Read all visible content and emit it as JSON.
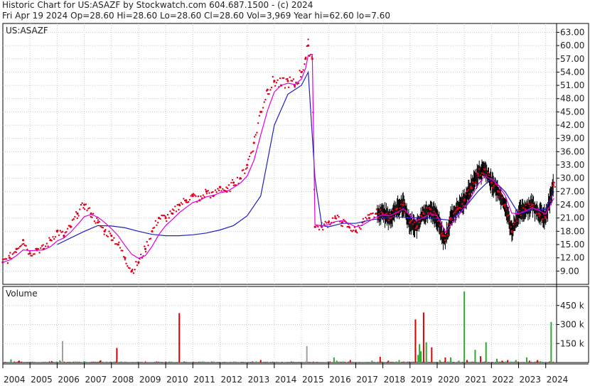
{
  "header": {
    "line1": "Historic Chart for US:ASAZF by Stockwatch.com 604.687.1500 - (c) 2024",
    "line2": "Fri Apr 19 2024   Op=28.60  Hi=28.60  Lo=28.60  Cl=28.60  Vol=3,969   Year hi=62.60   lo=7.60"
  },
  "colors": {
    "price_dot": "#e0001b",
    "ma_short": "#e000e0",
    "ma_long": "#2020c0",
    "grid": "#c8c8c8",
    "vol_up": "#2faa2f",
    "vol_down": "#e00000",
    "vol_flat": "#a0a0a0",
    "candle": "#000000"
  },
  "chart_data": [
    {
      "type": "line",
      "panel": "price",
      "label": "US:ASAZF",
      "y_ticks": [
        9,
        12,
        15,
        18,
        21,
        24,
        27,
        30,
        33,
        36,
        39,
        42,
        45,
        48,
        51,
        54,
        57,
        60,
        63
      ],
      "ylim": [
        6,
        65
      ],
      "xlim": [
        2004.0,
        2024.4
      ],
      "year_labels": [
        "2004",
        "2005",
        "2006",
        "2007",
        "2008",
        "2009",
        "2010",
        "2011",
        "2012",
        "2013",
        "2014",
        "2015",
        "2016",
        "2017",
        "2018",
        "2019",
        "2020",
        "2021",
        "2022",
        "2023",
        "2024"
      ],
      "grid": true,
      "series": [
        {
          "role": "price",
          "x": [
            2004.0,
            2004.25,
            2004.5,
            2004.75,
            2005.0,
            2005.25,
            2005.5,
            2005.75,
            2006.0,
            2006.25,
            2006.5,
            2006.75,
            2007.0,
            2007.25,
            2007.5,
            2007.75,
            2008.0,
            2008.25,
            2008.5,
            2008.75,
            2009.0,
            2009.25,
            2009.5,
            2009.75,
            2010.0,
            2010.25,
            2010.5,
            2010.75,
            2011.0,
            2011.25,
            2011.5,
            2011.75,
            2012.0,
            2012.25,
            2012.5,
            2012.75,
            2013.0,
            2013.25,
            2013.5,
            2013.75,
            2014.0,
            2014.25,
            2014.5,
            2014.75,
            2015.0,
            2015.15,
            2015.25,
            2015.4,
            2015.5,
            2015.75,
            2016.0,
            2016.25,
            2016.5,
            2016.75,
            2017.0,
            2017.25,
            2017.5,
            2017.75,
            2018.0,
            2018.25,
            2018.5,
            2018.75,
            2019.0,
            2019.25,
            2019.5,
            2019.75,
            2020.0,
            2020.2,
            2020.3,
            2020.5,
            2020.75,
            2021.0,
            2021.25,
            2021.5,
            2021.75,
            2022.0,
            2022.25,
            2022.5,
            2022.75,
            2023.0,
            2023.25,
            2023.5,
            2023.75,
            2024.0,
            2024.3
          ],
          "values": [
            11,
            12,
            14,
            16,
            13,
            14,
            14,
            16,
            18,
            17,
            19,
            22,
            24,
            22,
            20,
            18,
            17,
            15,
            12,
            9,
            11,
            14,
            18,
            21,
            21,
            22,
            24,
            25,
            26,
            25,
            27,
            26,
            28,
            27,
            29,
            30,
            33,
            38,
            45,
            50,
            52,
            51,
            52,
            51,
            54,
            57,
            60,
            57,
            19,
            19,
            20,
            21,
            20,
            19,
            18,
            20,
            21,
            22,
            22,
            21,
            23,
            24,
            20,
            19,
            22,
            23,
            21,
            17,
            16,
            21,
            23,
            25,
            28,
            31,
            32,
            29,
            27,
            24,
            18,
            22,
            23,
            24,
            22,
            21,
            29
          ]
        },
        {
          "role": "moving_average_short",
          "x": [
            2004.0,
            2004.25,
            2004.5,
            2004.75,
            2005.0,
            2005.25,
            2005.5,
            2005.75,
            2006.0,
            2006.25,
            2006.5,
            2006.75,
            2007.0,
            2007.25,
            2007.5,
            2007.75,
            2008.0,
            2008.25,
            2008.5,
            2008.75,
            2009.0,
            2009.25,
            2009.5,
            2009.75,
            2010.0,
            2010.25,
            2010.5,
            2010.75,
            2011.0,
            2011.25,
            2011.5,
            2011.75,
            2012.0,
            2012.25,
            2012.5,
            2012.75,
            2013.0,
            2013.25,
            2013.5,
            2013.75,
            2014.0,
            2014.25,
            2014.5,
            2014.75,
            2015.0,
            2015.15,
            2015.25,
            2015.4,
            2015.5,
            2015.75,
            2016.0,
            2016.25,
            2016.5,
            2016.75,
            2017.0,
            2017.25,
            2017.5,
            2017.75,
            2018.0,
            2018.25,
            2018.5,
            2018.75,
            2019.0,
            2019.25,
            2019.5,
            2019.75,
            2020.0,
            2020.2,
            2020.3,
            2020.5,
            2020.75,
            2021.0,
            2021.25,
            2021.5,
            2021.75,
            2022.0,
            2022.25,
            2022.5,
            2022.75,
            2023.0,
            2023.25,
            2023.5,
            2023.75,
            2024.0,
            2024.3
          ],
          "values": [
            11,
            11.5,
            12.5,
            13.8,
            13.6,
            13.7,
            13.8,
            14.5,
            15.8,
            16.5,
            17.8,
            19.5,
            21.3,
            21.8,
            21.2,
            20,
            18.6,
            17,
            14.8,
            12.8,
            11.9,
            12.5,
            14.6,
            17.3,
            19.3,
            20.7,
            22.2,
            23.4,
            24.5,
            25,
            25.8,
            26.1,
            26.7,
            27,
            27.9,
            28.9,
            30.5,
            34,
            39.8,
            45.3,
            49.5,
            51,
            51.5,
            51.2,
            52.4,
            54.8,
            57.8,
            58,
            19.5,
            19.2,
            19.5,
            20.2,
            20.4,
            19.8,
            19,
            19.4,
            20.3,
            21.2,
            21.7,
            21.5,
            22.2,
            23.1,
            21.6,
            20.4,
            21.1,
            22,
            21.5,
            19.2,
            17.8,
            19.4,
            21.3,
            23.3,
            25.7,
            28.5,
            30.5,
            29.8,
            28.4,
            26.2,
            22.1,
            22,
            22.6,
            23.3,
            22.7,
            21.9,
            25.5
          ]
        },
        {
          "role": "moving_average_long",
          "x": [
            2006.0,
            2006.5,
            2007.0,
            2007.5,
            2008.0,
            2008.5,
            2009.0,
            2009.5,
            2010.0,
            2010.5,
            2011.0,
            2011.5,
            2012.0,
            2012.5,
            2013.0,
            2013.5,
            2014.0,
            2014.5,
            2015.0,
            2015.25,
            2015.5,
            2015.75,
            2016.0,
            2016.5,
            2017.0,
            2017.5,
            2018.0,
            2018.5,
            2019.0,
            2019.5,
            2020.0,
            2020.5,
            2021.0,
            2021.5,
            2022.0,
            2022.5,
            2023.0,
            2023.5,
            2024.0,
            2024.3
          ],
          "values": [
            15,
            16.5,
            18,
            19.3,
            19.2,
            18.8,
            18,
            17.3,
            17,
            17,
            17.2,
            17.6,
            18.3,
            19.3,
            21.5,
            26,
            42,
            49,
            51,
            54,
            30,
            19.3,
            19,
            19.8,
            19.8,
            20.5,
            21,
            21.3,
            21,
            21.2,
            20.8,
            20.5,
            23.2,
            27,
            30,
            27,
            22,
            22.8,
            23,
            27
          ]
        }
      ]
    },
    {
      "type": "bar",
      "panel": "volume",
      "title": "Volume",
      "y_ticks": [
        "150 k",
        "300 k",
        "450 k"
      ],
      "ylim": [
        0,
        600
      ],
      "xlim": [
        2004.0,
        2024.4
      ],
      "series": [
        {
          "name": "up",
          "x": [
            2004.3,
            2006.1,
            2007.0,
            2016.2,
            2016.3,
            2017.6,
            2018.6,
            2019.3,
            2019.35,
            2019.4,
            2019.6,
            2020.1,
            2020.5,
            2020.8,
            2021.0,
            2021.4,
            2021.8,
            2022.2,
            2022.9,
            2023.3,
            2023.8,
            2024.2
          ],
          "values": [
            25,
            18,
            12,
            40,
            15,
            15,
            20,
            60,
            145,
            90,
            160,
            20,
            40,
            15,
            560,
            100,
            160,
            30,
            20,
            40,
            10,
            320
          ]
        },
        {
          "name": "down",
          "x": [
            2004.6,
            2005.8,
            2007.6,
            2008.2,
            2010.5,
            2013.5,
            2016.8,
            2017.9,
            2018.2,
            2019.2,
            2019.5,
            2019.8,
            2020.3,
            2021.1,
            2021.6,
            2022.4,
            2022.6,
            2023.4,
            2023.7
          ],
          "values": [
            15,
            12,
            18,
            115,
            390,
            20,
            20,
            45,
            15,
            340,
            395,
            120,
            40,
            20,
            50,
            15,
            20,
            15,
            20
          ]
        },
        {
          "name": "flat",
          "x": [
            2006.2,
            2015.2
          ],
          "values": [
            170,
            130
          ]
        }
      ]
    }
  ]
}
